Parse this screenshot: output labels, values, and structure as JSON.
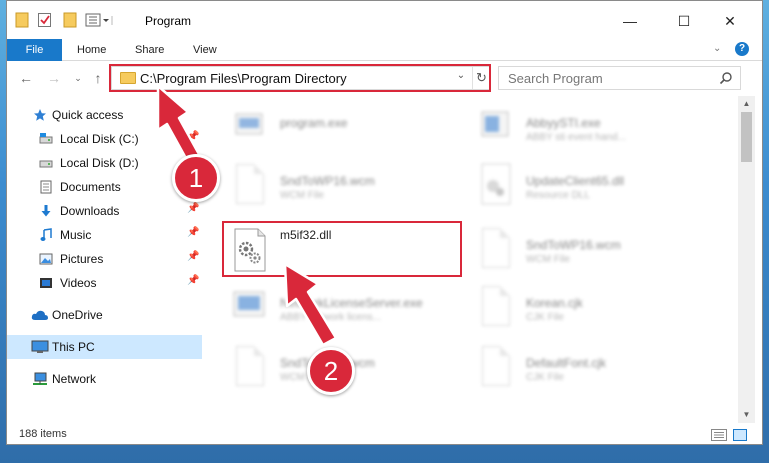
{
  "window": {
    "title": "Program",
    "minimize_glyph": "—",
    "maximize_glyph": "☐",
    "close_glyph": "✕"
  },
  "ribbon": {
    "tabs": [
      "File",
      "Home",
      "Share",
      "View"
    ],
    "help_glyph": "?"
  },
  "address": {
    "path": "C:\\Program Files\\Program Directory",
    "refresh_glyph": "↻"
  },
  "search": {
    "placeholder": "Search Program"
  },
  "nav_pane": {
    "items": [
      {
        "label": "Quick access",
        "icon": "star-icon"
      },
      {
        "label": "Local Disk (C:)",
        "icon": "drive-icon",
        "pinned": true
      },
      {
        "label": "Local Disk (D:)",
        "icon": "drive-icon"
      },
      {
        "label": "Documents",
        "icon": "documents-icon",
        "pinned": true
      },
      {
        "label": "Downloads",
        "icon": "download-icon",
        "pinned": true
      },
      {
        "label": "Music",
        "icon": "music-icon",
        "pinned": true
      },
      {
        "label": "Pictures",
        "icon": "pictures-icon",
        "pinned": true
      },
      {
        "label": "Videos",
        "icon": "videos-icon",
        "pinned": true
      },
      {
        "label": "OneDrive",
        "icon": "cloud-icon"
      },
      {
        "label": "This PC",
        "icon": "computer-icon",
        "selected": true
      },
      {
        "label": "Network",
        "icon": "network-icon"
      }
    ],
    "pin_glyph": "📌"
  },
  "files": [
    {
      "name": "program.exe",
      "type": ""
    },
    {
      "name": "AbbyySTI.exe",
      "type": "ABBY sti event hand..."
    },
    {
      "name": "SndToWP16.wcm",
      "type": "WCM File"
    },
    {
      "name": "UpdateClient65.dll",
      "type": "Resource DLL"
    },
    {
      "name": "m5if32.dll",
      "type": ""
    },
    {
      "name": "SndToWP16.wcm",
      "type": "WCM File"
    },
    {
      "name": "NetworkLicenseServer.exe",
      "type": "ABBY network licens..."
    },
    {
      "name": "Korean.cjk",
      "type": "CJK File"
    },
    {
      "name": "SndToWP16.wcm",
      "type": "WCM File"
    },
    {
      "name": "DefaultFont.cjk",
      "type": "CJK File"
    }
  ],
  "status": {
    "item_count": "188 items"
  },
  "annotations": {
    "step1": "1",
    "step2": "2",
    "color": "#d9283a"
  },
  "colors": {
    "accent": "#1979ca",
    "selection": "#cde8ff",
    "highlight_red": "#d9283a"
  }
}
